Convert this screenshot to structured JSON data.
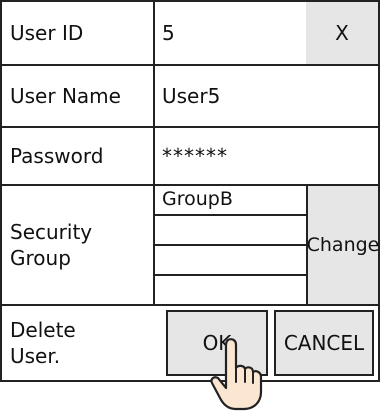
{
  "rows": {
    "user_id": {
      "label": "User ID",
      "value": "5",
      "close_label": "X"
    },
    "user_name": {
      "label": "User Name",
      "value": "User5"
    },
    "password": {
      "label": "Password",
      "value": "******"
    },
    "security_group": {
      "label_line1": "Security",
      "label_line2": "Group",
      "groups": [
        "GroupB",
        "",
        "",
        ""
      ],
      "change_label": "Change"
    },
    "delete_user": {
      "label_line1": "Delete",
      "label_line2": "User.",
      "ok_label": "OK",
      "cancel_label": "CANCEL"
    }
  },
  "colors": {
    "button_bg": "#e6e6e6",
    "border": "#222222"
  },
  "icons": {
    "pointer": "pointing-hand-icon"
  }
}
